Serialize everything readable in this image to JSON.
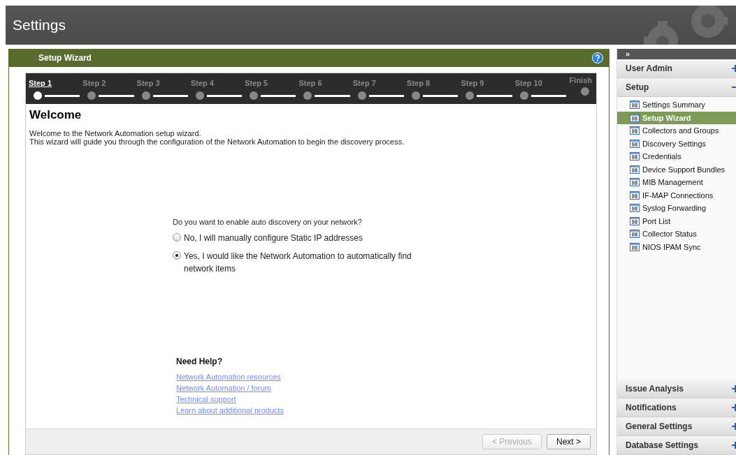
{
  "header": {
    "title": "Settings"
  },
  "wizard": {
    "title": "Setup Wizard",
    "steps": [
      {
        "label": "Step 1",
        "selected": true
      },
      {
        "label": "Step 2",
        "selected": false
      },
      {
        "label": "Step 3",
        "selected": false
      },
      {
        "label": "Step 4",
        "selected": false
      },
      {
        "label": "Step 5",
        "selected": false
      },
      {
        "label": "Step 6",
        "selected": false
      },
      {
        "label": "Step 7",
        "selected": false
      },
      {
        "label": "Step 8",
        "selected": false
      },
      {
        "label": "Step 9",
        "selected": false
      },
      {
        "label": "Step 10",
        "selected": false
      },
      {
        "label": "Finish",
        "selected": false
      }
    ],
    "heading": "Welcome",
    "intro": [
      "Welcome to the Network Automation setup wizard.",
      "This wizard will guide you through the configuration of the Network Automation to begin the discovery process."
    ],
    "question": "Do you want to enable auto discovery on your network?",
    "options": [
      {
        "label": "No, I will manually configure Static IP addresses",
        "selected": false
      },
      {
        "label": "Yes, I would like the Network Automation to automatically find network items",
        "selected": true
      }
    ],
    "help": {
      "title": "Need Help?",
      "links": [
        "Network Automation resources",
        "Network Automation / forum",
        "Technical support",
        "Learn about additional products"
      ]
    },
    "buttons": [
      {
        "label": "< Previous",
        "disabled": true
      },
      {
        "label": "Next >",
        "disabled": false
      }
    ]
  },
  "sidebar": {
    "collapse": "»",
    "groups": [
      {
        "label": "User Admin",
        "expanded": false
      },
      {
        "label": "Setup",
        "expanded": true,
        "items": [
          {
            "label": "Settings Summary",
            "selected": false
          },
          {
            "label": "Setup Wizard",
            "selected": true
          },
          {
            "label": "Collectors and Groups",
            "selected": false
          },
          {
            "label": "Discovery Settings",
            "selected": false
          },
          {
            "label": "Credentials",
            "selected": false
          },
          {
            "label": "Device Support Bundles",
            "selected": false
          },
          {
            "label": "MIB Management",
            "selected": false
          },
          {
            "label": "IF-MAP Connections",
            "selected": false
          },
          {
            "label": "Syslog Forwarding",
            "selected": false
          },
          {
            "label": "Port List",
            "selected": false
          },
          {
            "label": "Collector Status",
            "selected": false
          },
          {
            "label": "NIOS IPAM Sync",
            "selected": false
          }
        ]
      },
      {
        "label": "Issue Analysis",
        "expanded": false
      },
      {
        "label": "Notifications",
        "expanded": false
      },
      {
        "label": "General Settings",
        "expanded": false
      },
      {
        "label": "Database Settings",
        "expanded": false
      }
    ]
  }
}
